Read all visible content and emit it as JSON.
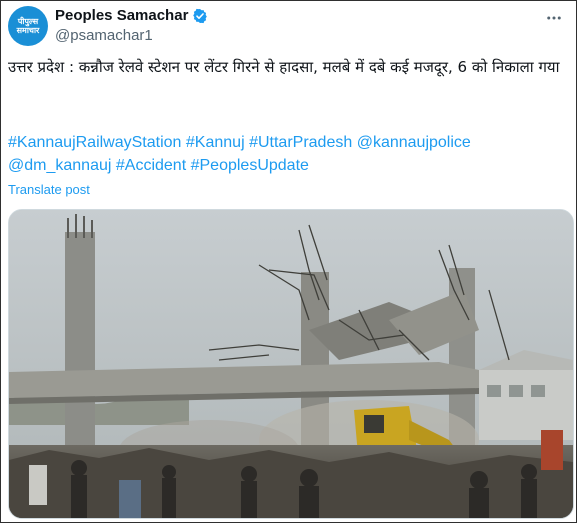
{
  "account": {
    "display_name": "Peoples Samachar",
    "handle": "@psamachar1",
    "avatar_text": "पीपुल्स\nसमाचार",
    "verified_color": "#1d9bf0"
  },
  "tweet": {
    "text": "उत्तर प्रदेश : कन्नौज रेलवे स्टेशन पर लेंटर गिरने से हादसा, मलबे में दबे कई मजदूर, 6 को निकाला गया",
    "hashtags": [
      "#KannaujRailwayStation",
      "#Kannuj",
      "#UttarPradesh",
      "@kannaujpolice",
      "@dm_kannauj",
      "#Accident",
      "#PeoplesUpdate"
    ],
    "translate_label": "Translate post"
  },
  "icons": {
    "more": "more-horizontal-icon",
    "verified": "verified-badge-icon"
  },
  "colors": {
    "link": "#1d9bf0",
    "text": "#0f1419",
    "secondary": "#536471"
  }
}
